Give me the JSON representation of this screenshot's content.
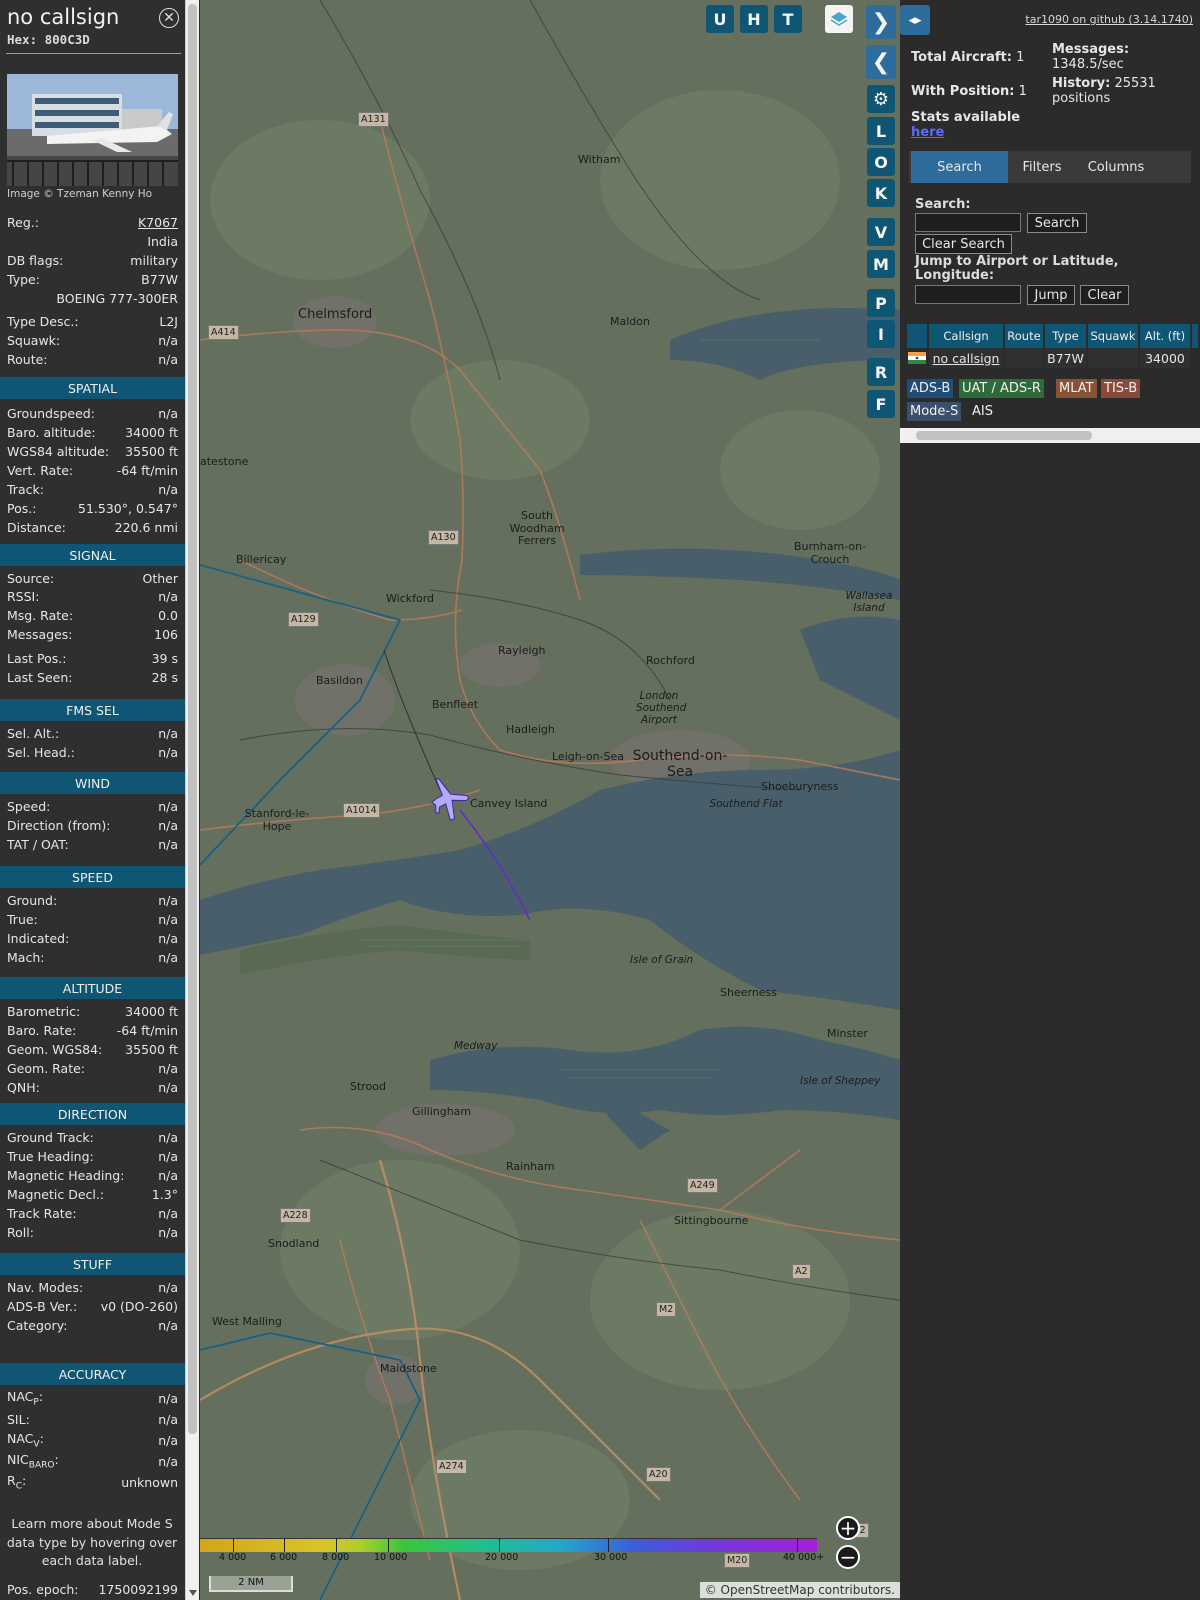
{
  "aircraft": {
    "callsign": "no callsign",
    "hex": "Hex: 800C3D",
    "photo_credit": "Image © Tzeman Kenny Ho",
    "reg_label": "Reg.:",
    "reg": "K7067",
    "country": "India",
    "dbflags_label": "DB flags:",
    "dbflags": "military",
    "type_label": "Type:",
    "type": "B77W",
    "type_full": "BOEING 777-300ER",
    "typedesc_label": "Type Desc.:",
    "typedesc": "L2J",
    "squawk_label": "Squawk:",
    "squawk": "n/a",
    "route_label": "Route:",
    "route": "n/a"
  },
  "sections": {
    "spatial": "SPATIAL",
    "signal": "SIGNAL",
    "fms": "FMS SEL",
    "wind": "WIND",
    "speed": "SPEED",
    "altitude": "ALTITUDE",
    "direction": "DIRECTION",
    "stuff": "STUFF",
    "accuracy": "ACCURACY"
  },
  "spatial": [
    {
      "label": "Groundspeed:",
      "value": "n/a"
    },
    {
      "label": "Baro. altitude:",
      "value": "34000 ft"
    },
    {
      "label": "WGS84 altitude:",
      "value": "35500 ft"
    },
    {
      "label": "Vert. Rate:",
      "value": "-64 ft/min"
    },
    {
      "label": "Track:",
      "value": "n/a"
    },
    {
      "label": "Pos.:",
      "value": "51.530°, 0.547°"
    },
    {
      "label": "Distance:",
      "value": "220.6 nmi"
    }
  ],
  "signal": [
    {
      "label": "Source:",
      "value": "Other"
    },
    {
      "label": "RSSI:",
      "value": "n/a"
    },
    {
      "label": "Msg. Rate:",
      "value": "0.0"
    },
    {
      "label": "Messages:",
      "value": "106"
    },
    {
      "label": "Last Pos.:",
      "value": "39 s"
    },
    {
      "label": "Last Seen:",
      "value": "28 s"
    }
  ],
  "fms": [
    {
      "label": "Sel. Alt.:",
      "value": "n/a"
    },
    {
      "label": "Sel. Head.:",
      "value": "n/a"
    }
  ],
  "wind": [
    {
      "label": "Speed:",
      "value": "n/a"
    },
    {
      "label": "Direction (from):",
      "value": "n/a"
    },
    {
      "label": "TAT / OAT:",
      "value": "n/a"
    }
  ],
  "speed": [
    {
      "label": "Ground:",
      "value": "n/a"
    },
    {
      "label": "True:",
      "value": "n/a"
    },
    {
      "label": "Indicated:",
      "value": "n/a"
    },
    {
      "label": "Mach:",
      "value": "n/a"
    }
  ],
  "altitude": [
    {
      "label": "Barometric:",
      "value": "34000 ft"
    },
    {
      "label": "Baro. Rate:",
      "value": "-64 ft/min"
    },
    {
      "label": "Geom. WGS84:",
      "value": "35500 ft"
    },
    {
      "label": "Geom. Rate:",
      "value": "n/a"
    },
    {
      "label": "QNH:",
      "value": "n/a"
    }
  ],
  "direction": [
    {
      "label": "Ground Track:",
      "value": "n/a"
    },
    {
      "label": "True Heading:",
      "value": "n/a"
    },
    {
      "label": "Magnetic Heading:",
      "value": "n/a"
    },
    {
      "label": "Magnetic Decl.:",
      "value": "1.3°"
    },
    {
      "label": "Track Rate:",
      "value": "n/a"
    },
    {
      "label": "Roll:",
      "value": "n/a"
    }
  ],
  "stuff": [
    {
      "label": "Nav. Modes:",
      "value": "n/a"
    },
    {
      "label": "ADS-B Ver.:",
      "value": "v0 (DO-260)"
    },
    {
      "label": "Category:",
      "value": "n/a"
    }
  ],
  "accuracy": [
    {
      "label": "NAC",
      "sub": "P",
      "value": "n/a"
    },
    {
      "label": "SIL:",
      "sub": "",
      "value": "n/a"
    },
    {
      "label": "NAC",
      "sub": "V",
      "value": "n/a"
    },
    {
      "label": "NIC",
      "sub": "BARO",
      "value": "n/a"
    },
    {
      "label": "R",
      "sub": "C",
      "value": "unknown"
    }
  ],
  "learn_more": "Learn more about Mode S data type by hovering over each data label.",
  "pos_epoch_label": "Pos. epoch:",
  "pos_epoch": "1750092199",
  "map": {
    "top_buttons": [
      "U",
      "H",
      "T"
    ],
    "side_buttons": [
      "L",
      "O",
      "K",
      "V",
      "M",
      "P",
      "I",
      "R",
      "F"
    ],
    "places": [
      {
        "name": "Chelmsford",
        "cls": "big"
      },
      {
        "name": "Maldon",
        "cls": ""
      },
      {
        "name": "Witham",
        "cls": ""
      },
      {
        "name": "South Woodham Ferrers",
        "cls": ""
      },
      {
        "name": "Burnham-on-Crouch",
        "cls": ""
      },
      {
        "name": "Wallasea Island",
        "cls": "italic"
      },
      {
        "name": "Billericay",
        "cls": ""
      },
      {
        "name": "Wickford",
        "cls": ""
      },
      {
        "name": "Rayleigh",
        "cls": ""
      },
      {
        "name": "Rochford",
        "cls": ""
      },
      {
        "name": "Basildon",
        "cls": ""
      },
      {
        "name": "Benfleet",
        "cls": ""
      },
      {
        "name": "Hadleigh",
        "cls": ""
      },
      {
        "name": "London Southend Airport",
        "cls": "italic"
      },
      {
        "name": "Leigh-on-Sea",
        "cls": ""
      },
      {
        "name": "Southend-on-Sea",
        "cls": "larger"
      },
      {
        "name": "Shoeburyness",
        "cls": ""
      },
      {
        "name": "Canvey Island",
        "cls": ""
      },
      {
        "name": "Stanford-le-Hope",
        "cls": ""
      },
      {
        "name": "Southend Flat",
        "cls": "italic"
      },
      {
        "name": "Isle of Grain",
        "cls": "italic"
      },
      {
        "name": "Sheerness",
        "cls": ""
      },
      {
        "name": "Minster",
        "cls": ""
      },
      {
        "name": "Isle of Sheppey",
        "cls": "italic"
      },
      {
        "name": "Medway",
        "cls": "italic"
      },
      {
        "name": "Strood",
        "cls": ""
      },
      {
        "name": "Gillingham",
        "cls": ""
      },
      {
        "name": "Rainham",
        "cls": ""
      },
      {
        "name": "Sittingbourne",
        "cls": ""
      },
      {
        "name": "Snodland",
        "cls": ""
      },
      {
        "name": "West Malling",
        "cls": ""
      },
      {
        "name": "Maidstone",
        "cls": ""
      },
      {
        "name": "atestone",
        "cls": ""
      }
    ],
    "roads": [
      "A131",
      "A414",
      "A130",
      "A129",
      "A1014",
      "A228",
      "A249",
      "A2",
      "M2",
      "A274",
      "A20",
      "M20",
      "A252"
    ],
    "alt_ticks": [
      "4 000",
      "6 000",
      "8 000",
      "10 000",
      "20 000",
      "30 000",
      "40 000+"
    ],
    "scale": "2 NM",
    "attribution_prefix": "© ",
    "attribution_link": "OpenStreetMap",
    "attribution_suffix": " contributors."
  },
  "right": {
    "version": "tar1090 on github (3.14.1740)",
    "total_aircraft_label": "Total Aircraft:",
    "total_aircraft": "1",
    "with_position_label": "With Position:",
    "with_position": "1",
    "messages_label": "Messages:",
    "messages_rate": "1348.5/sec",
    "history_label": "History:",
    "history_value": "25531",
    "history_unit": "positions",
    "stats_label": "Stats available",
    "stats_link": "here",
    "tabs": [
      "Search",
      "Filters",
      "Columns"
    ],
    "search_label": "Search:",
    "search_button": "Search",
    "clear_search_button": "Clear Search",
    "jump_label": "Jump to Airport or Latitude, Longitude:",
    "jump_button": "Jump",
    "clear_button": "Clear",
    "columns": [
      "Callsign",
      "Route",
      "Type",
      "Squawk",
      "Alt. (ft)"
    ],
    "row": {
      "callsign": "no callsign",
      "route": "",
      "type": "B77W",
      "squawk": "",
      "alt": "34000"
    },
    "sources": [
      {
        "label": "ADS-B",
        "color": "#1f4d78"
      },
      {
        "label": "UAT / ADS-R",
        "color": "#2e6b3a"
      },
      {
        "label": "MLAT",
        "color": "#8a5234"
      },
      {
        "label": "TIS-B",
        "color": "#8a4a3a"
      },
      {
        "label": "Mode-S",
        "color": "#3a4f6b"
      },
      {
        "label": "AIS",
        "color": "#2b2b2b"
      }
    ]
  }
}
